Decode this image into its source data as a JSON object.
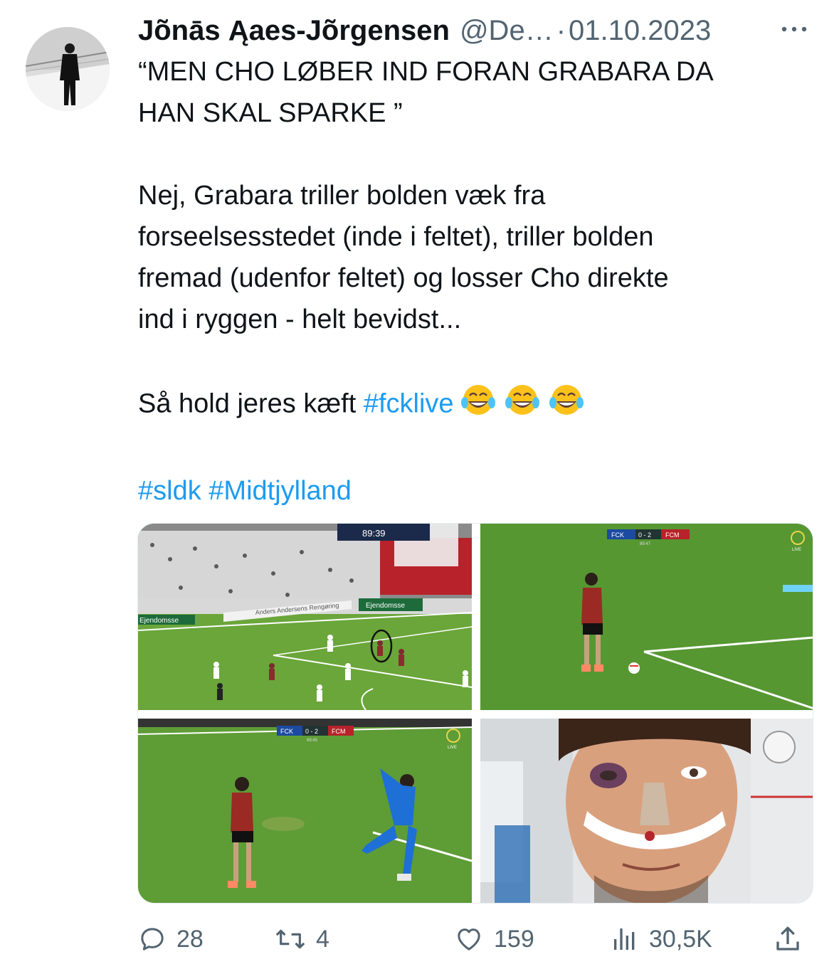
{
  "tweet": {
    "author_name": "Jõnās Ąaes-Jõrgensen",
    "handle": "@De…",
    "separator": "·",
    "date": "01.10.2023",
    "more_icon": "more-horizontal-icon",
    "text_line1": "“MEN CHO LØBER IND FORAN GRABARA DA",
    "text_line2": "HAN SKAL SPARKE ”",
    "text_para2_line1": "Nej, Grabara triller bolden væk fra",
    "text_para2_line2": "forseelsesstedet (inde i feltet), triller bolden",
    "text_para2_line3": "fremad (udenfor feltet) og losser Cho direkte",
    "text_para2_line4": "ind i ryggen - helt bevidst...",
    "text_para3": "Så hold jeres kæft ",
    "hashtag_fcklive": "#fcklive",
    "emoji": "😂😂😂",
    "hashtag_sldk": "#sldk",
    "hashtag_midtjylland": "#Midtjylland"
  },
  "media": {
    "image1": {
      "scoreboard_time": "89:39",
      "banner1": "Anders Andersens Rengøring",
      "banner2": "Ejendomsse",
      "banner3": "Ejendomsse"
    },
    "image2": {
      "home": "FCK",
      "score": "0 - 2",
      "away": "FCM",
      "clock": "89:47",
      "live": "LIVE"
    },
    "image3": {
      "home": "FCK",
      "score": "0 - 2",
      "away": "FCM",
      "clock": "89:45",
      "live": "LIVE"
    }
  },
  "actions": {
    "replies": "28",
    "retweets": "4",
    "likes": "159",
    "views": "30,5K"
  },
  "colors": {
    "link": "#1d9bf0",
    "secondary": "#536471",
    "text": "#0f1419"
  }
}
